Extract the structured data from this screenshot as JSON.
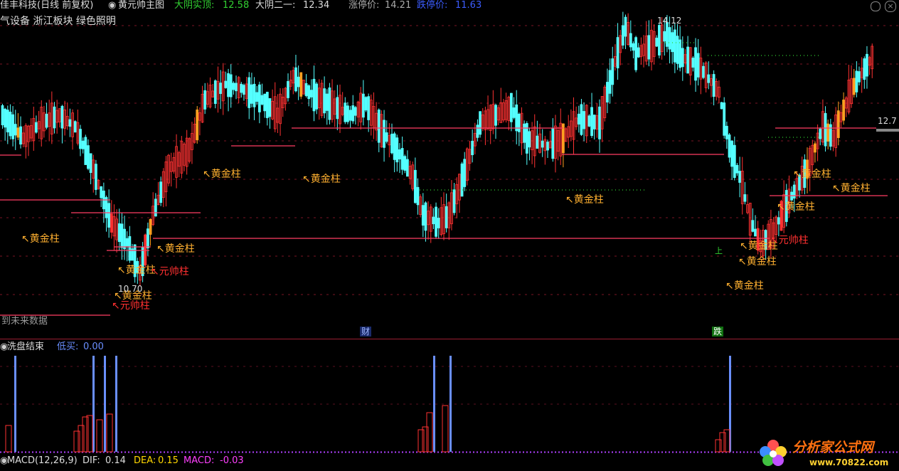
{
  "header": {
    "stock_name": "佳丰科技(日线 前复权)",
    "indicator": "黄元帅主图",
    "label_1": "大阴实顶:",
    "value_1": "12.58",
    "label_2": "大阴二一:",
    "value_2": "12.34",
    "label_3": "涨停价:",
    "value_3": "14.21",
    "label_4": "跌停价:",
    "value_4": "11.63"
  },
  "sectors": "气设备 浙江板块 绿色照明",
  "price_marks": {
    "high": "14.12",
    "low": "10.70",
    "last": "12.7"
  },
  "notes": {
    "future_data": "到未来数据",
    "cai": "财",
    "die": "跌",
    "up": "上"
  },
  "candle_labels": {
    "gold": "黄金柱",
    "red": "元帅柱"
  },
  "sub_panel": {
    "title": "洗盘结束",
    "low_buy_label": "低买:",
    "low_buy_value": "0.00"
  },
  "macd": {
    "label": "MACD(12,26,9)",
    "dif_label": "DIF:",
    "dif": "0.14",
    "dea_label": "DEA:",
    "dea": "0.15",
    "macd_label": "MACD:",
    "macd": "-0.03"
  },
  "watermark": {
    "title": "分析家公式网",
    "url": "www.70822.com"
  },
  "colors": {
    "up": "#ff3232",
    "down": "#54ffff",
    "gold": "#ffa020",
    "line": "#ff3c64",
    "blue_bar": "#6a8fff"
  }
}
